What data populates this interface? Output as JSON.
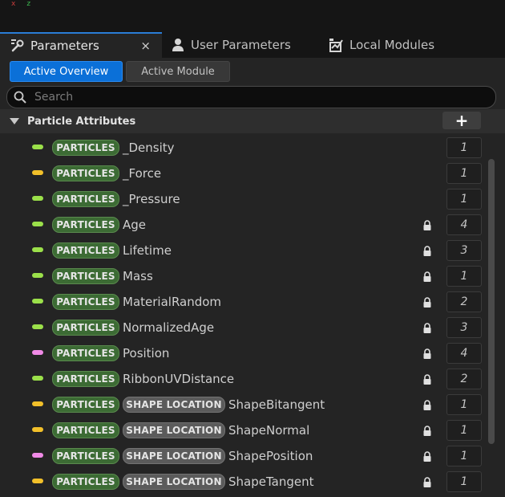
{
  "tabs": [
    {
      "label": "Parameters",
      "icon": "wrench-icon",
      "active": true,
      "closable": true
    },
    {
      "label": "User Parameters",
      "icon": "user-icon",
      "active": false
    },
    {
      "label": "Local Modules",
      "icon": "module-icon",
      "active": false
    }
  ],
  "close_glyph": "×",
  "view_toggle": {
    "active": "Active Overview",
    "inactive": "Active Module"
  },
  "search": {
    "placeholder": "Search"
  },
  "category": {
    "title": "Particle Attributes",
    "add_glyph": "+"
  },
  "attributes": [
    {
      "tags": [
        "PARTICLES"
      ],
      "name": "_Density",
      "type_color": "#9be04a",
      "locked": false,
      "count": "1"
    },
    {
      "tags": [
        "PARTICLES"
      ],
      "name": "_Force",
      "type_color": "#f2c02a",
      "locked": false,
      "count": "1"
    },
    {
      "tags": [
        "PARTICLES"
      ],
      "name": "_Pressure",
      "type_color": "#9be04a",
      "locked": false,
      "count": "1"
    },
    {
      "tags": [
        "PARTICLES"
      ],
      "name": "Age",
      "type_color": "#9be04a",
      "locked": true,
      "count": "4"
    },
    {
      "tags": [
        "PARTICLES"
      ],
      "name": "Lifetime",
      "type_color": "#9be04a",
      "locked": true,
      "count": "3"
    },
    {
      "tags": [
        "PARTICLES"
      ],
      "name": "Mass",
      "type_color": "#9be04a",
      "locked": true,
      "count": "1"
    },
    {
      "tags": [
        "PARTICLES"
      ],
      "name": "MaterialRandom",
      "type_color": "#9be04a",
      "locked": true,
      "count": "2"
    },
    {
      "tags": [
        "PARTICLES"
      ],
      "name": "NormalizedAge",
      "type_color": "#9be04a",
      "locked": true,
      "count": "3"
    },
    {
      "tags": [
        "PARTICLES"
      ],
      "name": "Position",
      "type_color": "#f08ae6",
      "locked": true,
      "count": "4"
    },
    {
      "tags": [
        "PARTICLES"
      ],
      "name": "RibbonUVDistance",
      "type_color": "#9be04a",
      "locked": true,
      "count": "2"
    },
    {
      "tags": [
        "PARTICLES",
        "SHAPE LOCATION"
      ],
      "name": "ShapeBitangent",
      "type_color": "#f2c02a",
      "locked": true,
      "count": "1"
    },
    {
      "tags": [
        "PARTICLES",
        "SHAPE LOCATION"
      ],
      "name": "ShapeNormal",
      "type_color": "#f2c02a",
      "locked": true,
      "count": "1"
    },
    {
      "tags": [
        "PARTICLES",
        "SHAPE LOCATION"
      ],
      "name": "ShapePosition",
      "type_color": "#f08ae6",
      "locked": true,
      "count": "1"
    },
    {
      "tags": [
        "PARTICLES",
        "SHAPE LOCATION"
      ],
      "name": "ShapeTangent",
      "type_color": "#f2c02a",
      "locked": true,
      "count": "1"
    }
  ]
}
